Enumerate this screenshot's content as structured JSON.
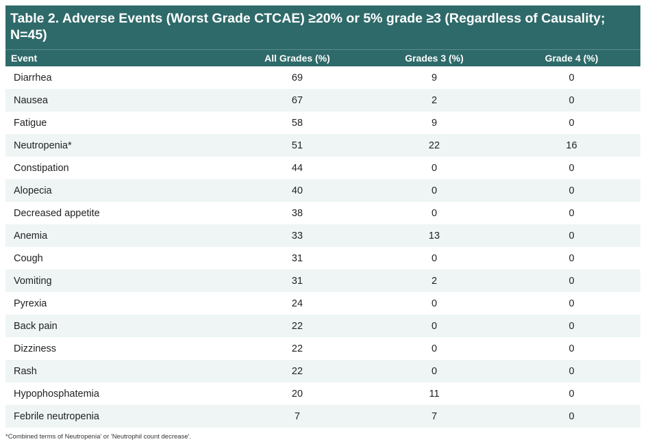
{
  "table": {
    "title": "Table 2. Adverse Events (Worst Grade CTCAE) ≥20% or 5% grade ≥3 (Regardless of Causality; N=45)",
    "headers": [
      "Event",
      "All Grades (%)",
      "Grades 3 (%)",
      "Grade 4 (%)"
    ],
    "rows": [
      [
        "Diarrhea",
        "69",
        "9",
        "0"
      ],
      [
        "Nausea",
        "67",
        "2",
        "0"
      ],
      [
        "Fatigue",
        "58",
        "9",
        "0"
      ],
      [
        "Neutropenia*",
        "51",
        "22",
        "16"
      ],
      [
        "Constipation",
        "44",
        "0",
        "0"
      ],
      [
        "Alopecia",
        "40",
        "0",
        "0"
      ],
      [
        "Decreased appetite",
        "38",
        "0",
        "0"
      ],
      [
        "Anemia",
        "33",
        "13",
        "0"
      ],
      [
        "Cough",
        "31",
        "0",
        "0"
      ],
      [
        "Vomiting",
        "31",
        "2",
        "0"
      ],
      [
        "Pyrexia",
        "24",
        "0",
        "0"
      ],
      [
        "Back pain",
        "22",
        "0",
        "0"
      ],
      [
        "Dizziness",
        "22",
        "0",
        "0"
      ],
      [
        "Rash",
        "22",
        "0",
        "0"
      ],
      [
        "Hypophosphatemia",
        "20",
        "11",
        "0"
      ],
      [
        "Febrile neutropenia",
        "7",
        "7",
        "0"
      ]
    ],
    "footnote": "*Combined terms of Neutropenia' or 'Neutrophil count decrease'."
  },
  "colors": {
    "header_bg": "#2f6a6a",
    "stripe_bg": "#eef5f4"
  }
}
